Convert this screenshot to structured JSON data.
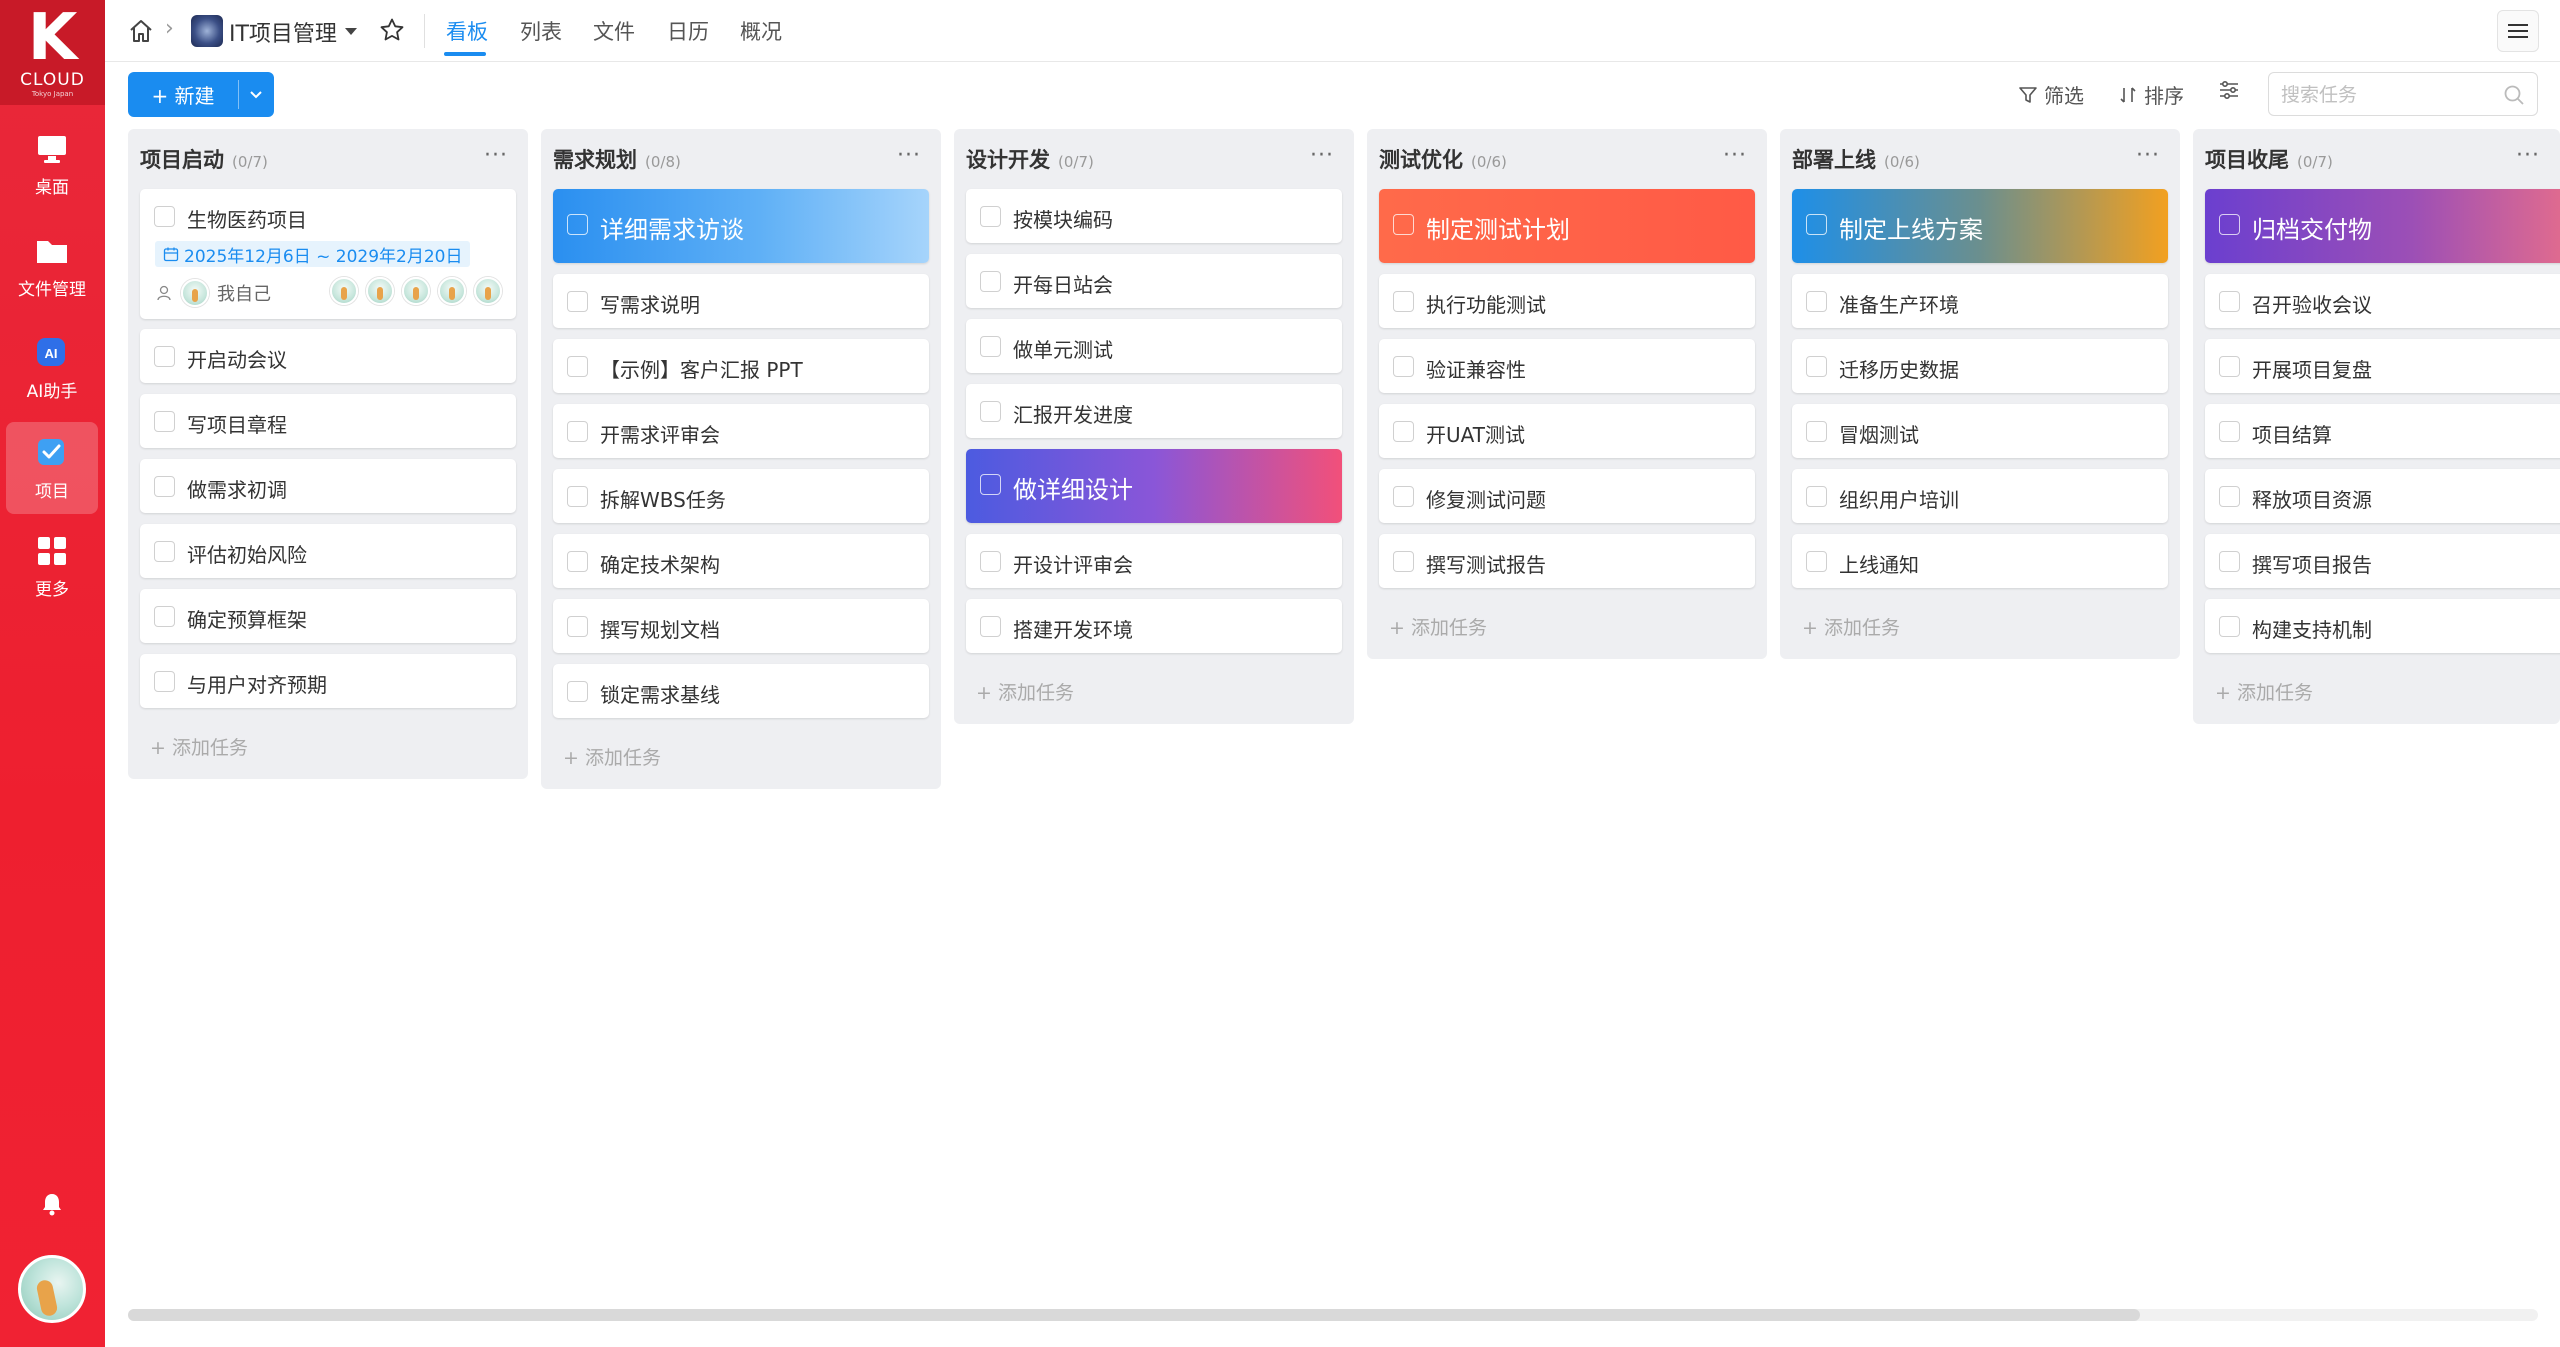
{
  "sidebar": {
    "logo_text": "CLOUD",
    "logo_sub": "Tokyo Japan",
    "items": [
      {
        "label": "桌面",
        "icon": "desktop-icon"
      },
      {
        "label": "文件管理",
        "icon": "folder-icon"
      },
      {
        "label": "AI助手",
        "icon": "ai-icon"
      },
      {
        "label": "项目",
        "icon": "project-check-icon",
        "active": true
      },
      {
        "label": "更多",
        "icon": "grid-icon"
      }
    ]
  },
  "header": {
    "project_title": "IT项目管理",
    "tabs": [
      "看板",
      "列表",
      "文件",
      "日历",
      "概况"
    ],
    "active_tab": "看板"
  },
  "toolbar": {
    "new_label": "+ 新建",
    "filter_label": "筛选",
    "sort_label": "排序",
    "search_placeholder": "搜索任务"
  },
  "board": {
    "add_task_label": "添加任务",
    "columns": [
      {
        "title": "项目启动",
        "count": "(0/7)",
        "first_card": {
          "title": "生物医药项目",
          "date_range": "2025年12月6日 ~ 2029年2月20日",
          "owner": "我自己",
          "member_count": 5
        },
        "cards": [
          "开启动会议",
          "写项目章程",
          "做需求初调",
          "评估初始风险",
          "确定预算框架",
          "与用户对齐预期"
        ]
      },
      {
        "title": "需求规划",
        "count": "(0/8)",
        "highlight": {
          "title": "详细需求访谈",
          "color": "blue"
        },
        "cards": [
          "写需求说明",
          "【示例】客户汇报 PPT",
          "开需求评审会",
          "拆解WBS任务",
          "确定技术架构",
          "撰写规划文档",
          "锁定需求基线"
        ]
      },
      {
        "title": "设计开发",
        "count": "(0/7)",
        "cards_before": [
          "按模块编码",
          "开每日站会",
          "做单元测试",
          "汇报开发进度"
        ],
        "highlight": {
          "title": "做详细设计",
          "color": "purple"
        },
        "cards": [
          "开设计评审会",
          "搭建开发环境"
        ]
      },
      {
        "title": "测试优化",
        "count": "(0/6)",
        "highlight": {
          "title": "制定测试计划",
          "color": "orange"
        },
        "cards": [
          "执行功能测试",
          "验证兼容性",
          "开UAT测试",
          "修复测试问题",
          "撰写测试报告"
        ]
      },
      {
        "title": "部署上线",
        "count": "(0/6)",
        "highlight": {
          "title": "制定上线方案",
          "color": "deploy"
        },
        "cards": [
          "准备生产环境",
          "迁移历史数据",
          "冒烟测试",
          "组织用户培训",
          "上线通知"
        ]
      },
      {
        "title": "项目收尾",
        "count": "(0/7)",
        "highlight": {
          "title": "归档交付物",
          "color": "archive"
        },
        "cards": [
          "召开验收会议",
          "开展项目复盘",
          "项目结算",
          "释放项目资源",
          "撰写项目报告",
          "构建支持机制"
        ]
      }
    ]
  },
  "colors": {
    "brand_red": "#ee1f2f",
    "accent_blue": "#1a8cf0"
  }
}
